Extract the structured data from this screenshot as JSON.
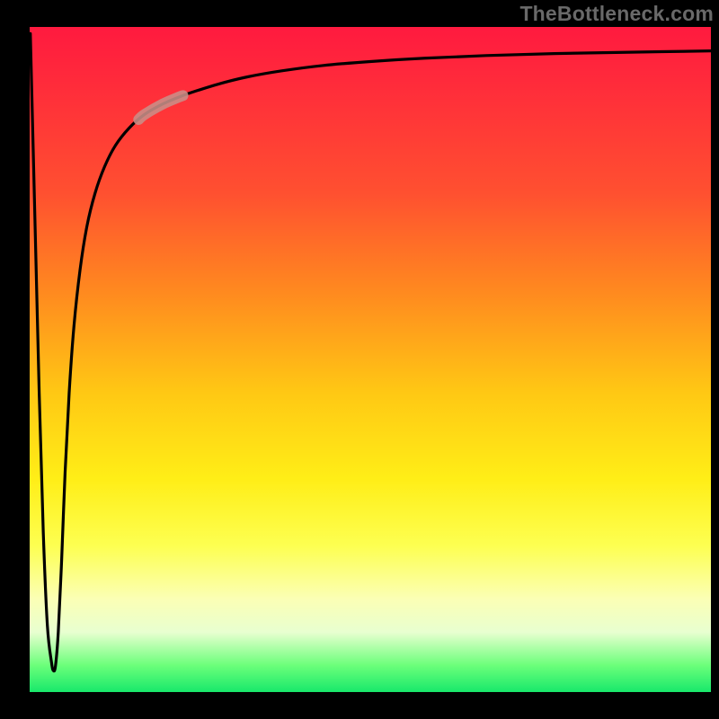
{
  "watermark": "TheBottleneck.com",
  "chart_data": {
    "type": "line",
    "title": "",
    "xlabel": "",
    "ylabel": "",
    "xlim": [
      0,
      100
    ],
    "ylim": [
      0,
      100
    ],
    "series": [
      {
        "name": "bottleneck-curve",
        "x": [
          0.1,
          0.8,
          1.4,
          2.0,
          2.6,
          3.2,
          3.5,
          3.8,
          4.2,
          4.7,
          5.2,
          5.8,
          6.5,
          7.4,
          8.4,
          9.6,
          11.0,
          12.6,
          14.6,
          16.8,
          19.5,
          22.0,
          24.5,
          28.0,
          32.0,
          37.0,
          43.0,
          50.0,
          58.0,
          67.0,
          77.0,
          88.0,
          100.0
        ],
        "y": [
          99.0,
          70.0,
          45.0,
          24.0,
          10.0,
          4.5,
          3.2,
          4.0,
          9.0,
          20.0,
          33.0,
          45.0,
          55.0,
          63.5,
          70.0,
          75.0,
          79.0,
          82.2,
          84.8,
          86.8,
          88.4,
          89.5,
          90.4,
          91.5,
          92.5,
          93.4,
          94.2,
          94.8,
          95.3,
          95.7,
          96.0,
          96.2,
          96.4
        ]
      }
    ],
    "highlight_segment": {
      "x_start": 16.0,
      "x_end": 22.5
    },
    "background_gradient": {
      "direction": "top-to-bottom",
      "stops": [
        {
          "pos": 0.0,
          "color": "#ff1a3f"
        },
        {
          "pos": 0.25,
          "color": "#ff5030"
        },
        {
          "pos": 0.55,
          "color": "#ffc814"
        },
        {
          "pos": 0.78,
          "color": "#fdff51"
        },
        {
          "pos": 0.91,
          "color": "#e8ffd0"
        },
        {
          "pos": 1.0,
          "color": "#18e86b"
        }
      ]
    }
  }
}
